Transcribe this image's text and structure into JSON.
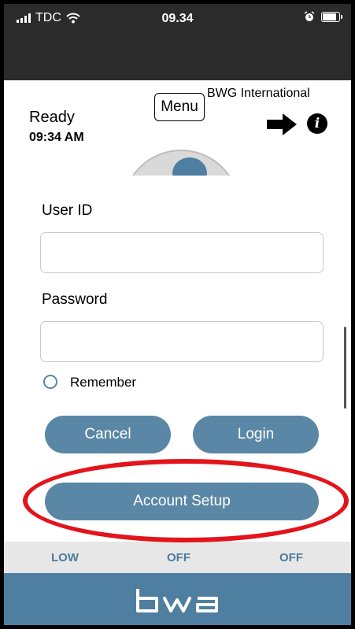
{
  "status_bar": {
    "carrier": "TDC",
    "time": "09.34"
  },
  "header": {
    "ready": "Ready",
    "time": "09:34 AM",
    "menu_label": "Menu",
    "brand": "BWG International"
  },
  "login": {
    "user_id_label": "User ID",
    "user_id_value": "",
    "password_label": "Password",
    "password_value": "",
    "remember_label": "Remember",
    "remember_checked": false,
    "cancel_label": "Cancel",
    "login_label": "Login",
    "account_setup_label": "Account Setup"
  },
  "status_row": {
    "left": "LOW",
    "middle": "OFF",
    "right": "OFF"
  },
  "footer": {
    "logo_text": "bwa"
  },
  "colors": {
    "accent": "#5a87a6",
    "footer": "#4f7fa0",
    "highlight": "#e3141b",
    "status_text": "#4d7c99"
  },
  "icons": [
    "signal-icon",
    "wifi-icon",
    "alarm-icon",
    "battery-icon",
    "arrow-right-icon",
    "info-icon"
  ]
}
